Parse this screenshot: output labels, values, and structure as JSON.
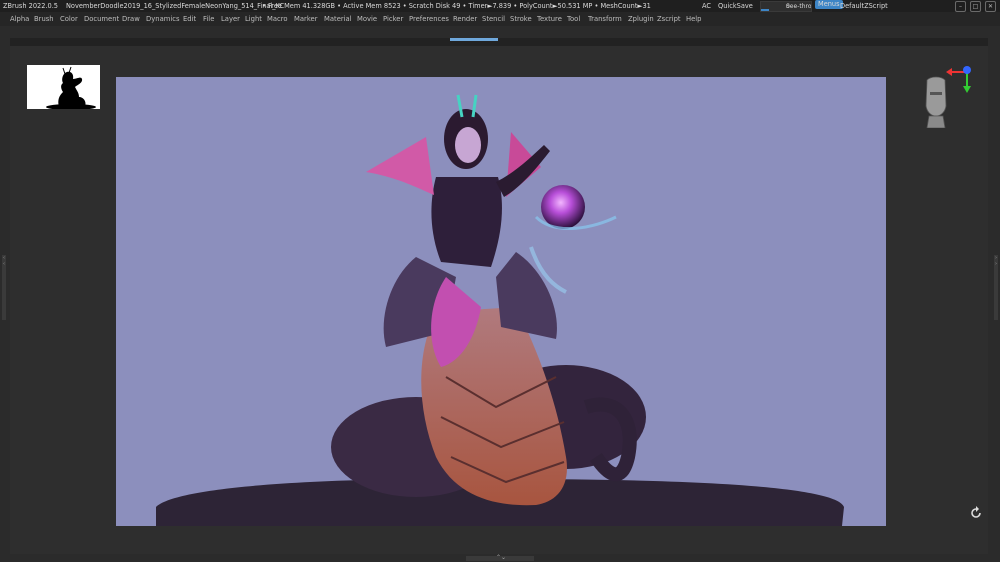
{
  "titlebar": {
    "app": "ZBrush 2022.0.5",
    "document": "NovemberDoodle2019_16_StylizedFemaleNeonYang_514_Final_KC",
    "stats": "• Free Mem 41.328GB • Active Mem 8523 • Scratch Disk 49 •  Timer►7.839 • PolyCount►50.531 MP  • MeshCount►31",
    "ac": "AC",
    "quicksave": "QuickSave",
    "see_through_label": "See-through",
    "see_through_value": "0",
    "menus": "Menus",
    "zscript": "DefaultZScript"
  },
  "menu": {
    "items": [
      "Alpha",
      "Brush",
      "Color",
      "Document",
      "Draw",
      "Dynamics",
      "Edit",
      "File",
      "Layer",
      "Light",
      "Macro",
      "Marker",
      "Material",
      "Movie",
      "Picker",
      "Preferences",
      "Render",
      "Stencil",
      "Stroke",
      "Texture",
      "Tool",
      "Transform",
      "Zplugin",
      "Zscript",
      "Help"
    ]
  },
  "colors": {
    "canvas_bg": "#8c8fbd",
    "accent": "#3d85c6"
  },
  "icons": {
    "window": [
      "minimize-icon",
      "maximize-icon",
      "close-icon"
    ],
    "navigation_head": "head-navigation-icon",
    "axis_gizmo": "axis-gizmo-icon",
    "rotate": "rotate-icon"
  }
}
